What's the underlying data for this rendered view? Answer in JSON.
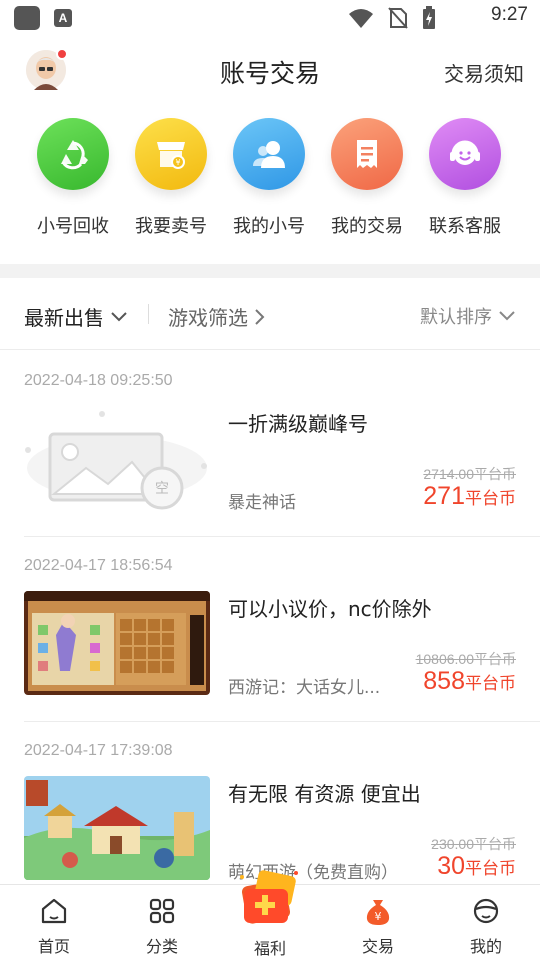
{
  "status_bar": {
    "time": "9:27",
    "notif_badge": "A"
  },
  "header": {
    "title": "账号交易",
    "notice_link": "交易须知"
  },
  "quick_entries": [
    {
      "label": "小号回收",
      "icon": "recycle-icon",
      "color": "#4cc93c"
    },
    {
      "label": "我要卖号",
      "icon": "shop-icon",
      "color": "#f7c81f"
    },
    {
      "label": "我的小号",
      "icon": "users-icon",
      "color": "#4aaef0"
    },
    {
      "label": "我的交易",
      "icon": "receipt-icon",
      "color": "#f6825a"
    },
    {
      "label": "联系客服",
      "icon": "support-icon",
      "color": "#c96ae8"
    }
  ],
  "filter": {
    "latest": "最新出售",
    "game_filter": "游戏筛选",
    "sort": "默认排序"
  },
  "listings": [
    {
      "date": "2022-04-18 09:25:50",
      "title": "一折满级巅峰号",
      "game": "暴走神话",
      "original_price": "2714.00平台币",
      "price": "271",
      "unit": "平台币",
      "thumb": "empty",
      "empty_badge": "空"
    },
    {
      "date": "2022-04-17 18:56:54",
      "title": "可以小议价，nc价除外",
      "game": "西游记：大话女儿...",
      "original_price": "10806.00平台币",
      "price": "858",
      "unit": "平台币",
      "thumb": "game1"
    },
    {
      "date": "2022-04-17 17:39:08",
      "title": "有无限 有资源 便宜出",
      "game": "萌幻西游（免费直购）",
      "original_price": "230.00平台币",
      "price": "30",
      "unit": "平台币",
      "thumb": "game2"
    }
  ],
  "tabbar": [
    {
      "label": "首页",
      "icon": "home-icon"
    },
    {
      "label": "分类",
      "icon": "category-icon"
    },
    {
      "label": "福利",
      "icon": "gift-icon"
    },
    {
      "label": "交易",
      "icon": "money-bag-icon"
    },
    {
      "label": "我的",
      "icon": "profile-icon"
    }
  ]
}
